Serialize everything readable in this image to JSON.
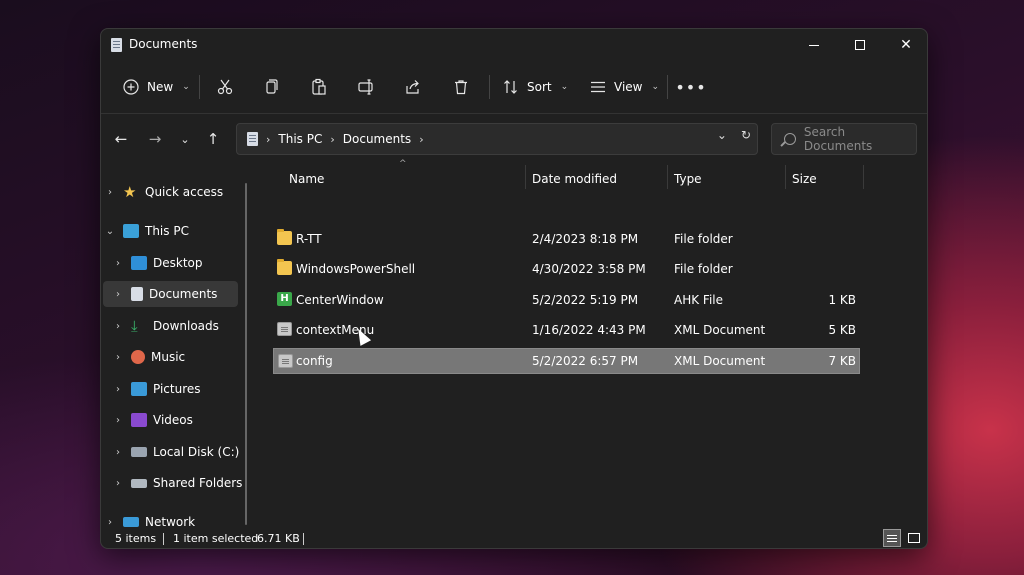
{
  "window": {
    "title": "Documents"
  },
  "toolbar": {
    "new_label": "New",
    "sort_label": "Sort",
    "view_label": "View"
  },
  "address": {
    "crumbs": [
      "This PC",
      "Documents"
    ]
  },
  "search": {
    "placeholder": "Search Documents"
  },
  "sidebar": {
    "items": [
      {
        "label": "Quick access",
        "icon": "star-icon"
      },
      {
        "label": "This PC",
        "icon": "computer-icon"
      },
      {
        "label": "Desktop",
        "icon": "desktop-icon"
      },
      {
        "label": "Documents",
        "icon": "documents-icon"
      },
      {
        "label": "Downloads",
        "icon": "download-icon"
      },
      {
        "label": "Music",
        "icon": "music-icon"
      },
      {
        "label": "Pictures",
        "icon": "pictures-icon"
      },
      {
        "label": "Videos",
        "icon": "videos-icon"
      },
      {
        "label": "Local Disk (C:)",
        "icon": "disk-icon"
      },
      {
        "label": "Shared Folders",
        "icon": "shared-folder-icon"
      },
      {
        "label": "Network",
        "icon": "network-icon"
      }
    ]
  },
  "columns": {
    "name": "Name",
    "date": "Date modified",
    "type": "Type",
    "size": "Size"
  },
  "files": [
    {
      "name": "R-TT",
      "date": "2/4/2023 8:18 PM",
      "type": "File folder",
      "size": "",
      "icon": "folder-icon"
    },
    {
      "name": "WindowsPowerShell",
      "date": "4/30/2022 3:58 PM",
      "type": "File folder",
      "size": "",
      "icon": "folder-icon"
    },
    {
      "name": "CenterWindow",
      "date": "5/2/2022 5:19 PM",
      "type": "AHK File",
      "size": "1 KB",
      "icon": "ahk-file-icon"
    },
    {
      "name": "contextMenu",
      "date": "1/16/2022 4:43 PM",
      "type": "XML Document",
      "size": "5 KB",
      "icon": "xml-file-icon"
    },
    {
      "name": "config",
      "date": "5/2/2022 6:57 PM",
      "type": "XML Document",
      "size": "7 KB",
      "icon": "xml-file-icon"
    }
  ],
  "status": {
    "item_count": "5 items",
    "selection": "1 item selected",
    "selection_size": "6.71 KB"
  }
}
